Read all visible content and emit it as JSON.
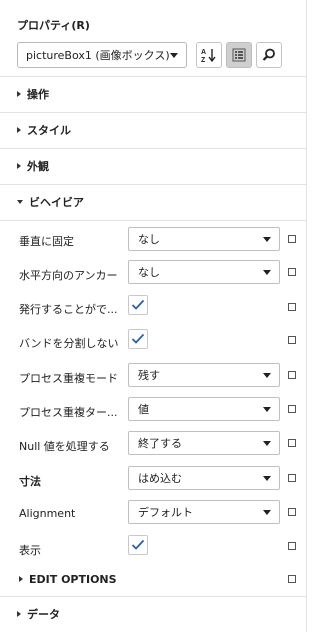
{
  "panel": {
    "title": "プロパティ(R)",
    "object_selector": {
      "value": "pictureBox1 (画像ボックス)"
    },
    "toolbar": {
      "sort_icon": "sort-alphabetical-icon",
      "categorized_icon": "categorized-list-icon",
      "search_icon": "search-icon"
    },
    "categories_top": [
      {
        "label": "操作"
      },
      {
        "label": "スタイル"
      },
      {
        "label": "外観"
      }
    ],
    "behavior": {
      "label": "ビヘイビア",
      "properties": [
        {
          "label": "垂直に固定",
          "type": "dropdown",
          "value": "なし"
        },
        {
          "label": "水平方向のアンカー",
          "type": "dropdown",
          "value": "なし"
        },
        {
          "label": "発行することがで...",
          "type": "checkbox",
          "checked": true
        },
        {
          "label": "バンドを分割しない",
          "type": "checkbox",
          "checked": true
        },
        {
          "label": "プロセス重複モード",
          "type": "dropdown",
          "value": "残す"
        },
        {
          "label": "プロセス重複ター...",
          "type": "dropdown",
          "value": "値"
        },
        {
          "label": "Null 値を処理する",
          "type": "dropdown",
          "value": "終了する"
        },
        {
          "label": "寸法",
          "type": "dropdown",
          "value": "はめ込む",
          "bold": true
        },
        {
          "label": "Alignment",
          "type": "dropdown",
          "value": "デフォルト"
        },
        {
          "label": "表示",
          "type": "checkbox",
          "checked": true
        }
      ],
      "edit_options": {
        "label": "EDIT OPTIONS"
      }
    },
    "categories_bottom": [
      {
        "label": "データ"
      }
    ]
  }
}
